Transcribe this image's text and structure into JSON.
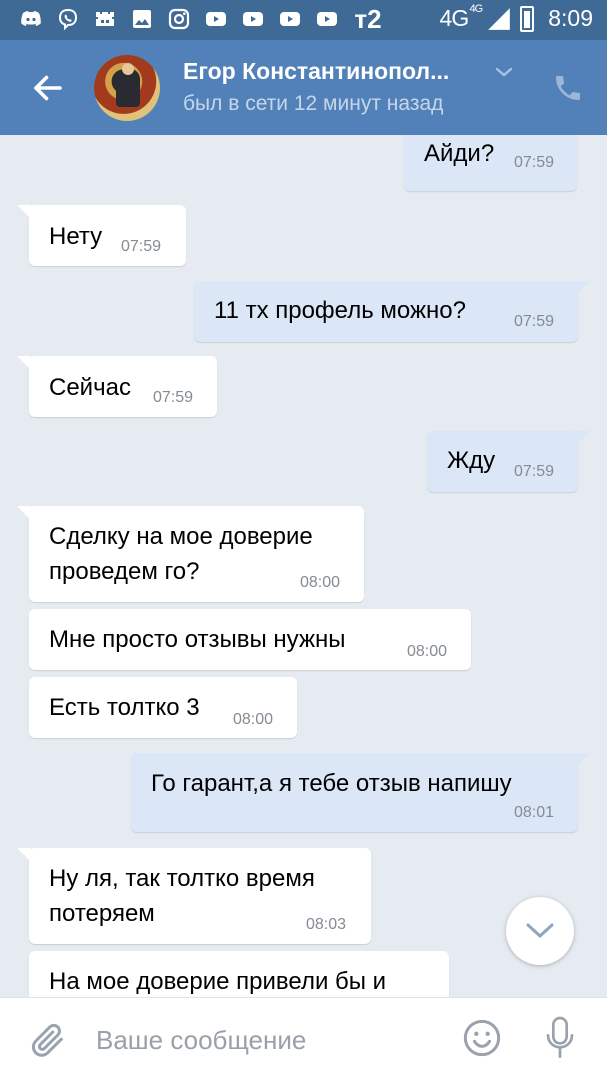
{
  "status_bar": {
    "icons": [
      "discord-icon",
      "viber-icon",
      "game-icon",
      "gallery-icon",
      "instagram-icon",
      "youtube-icon",
      "youtube-icon",
      "youtube-icon",
      "youtube-icon",
      "tele2-icon"
    ],
    "tele2_label": "т2",
    "network": "4G",
    "network_sup": "4G",
    "time": "8:09"
  },
  "header": {
    "contact_name": "Егор Константинопол...",
    "last_seen": "был в сети 12 минут назад"
  },
  "colors": {
    "header_bg": "#5181b8",
    "status_bg": "#3f6a95",
    "incoming_bubble": "#ffffff",
    "outgoing_bubble": "#dbe7f6",
    "chat_bg": "#e5ebf1"
  },
  "messages": [
    {
      "dir": "out",
      "lines": [
        "Айди?"
      ],
      "time": "07:59"
    },
    {
      "dir": "in",
      "lines": [
        "Нету"
      ],
      "time": "07:59"
    },
    {
      "dir": "out",
      "lines": [
        "11 тх профель можно?"
      ],
      "time": "07:59"
    },
    {
      "dir": "in",
      "lines": [
        "Сейчас"
      ],
      "time": "07:59"
    },
    {
      "dir": "out",
      "lines": [
        "Жду"
      ],
      "time": "07:59"
    },
    {
      "dir": "in",
      "lines": [
        "Сделку на мое доверие",
        "проведем го?"
      ],
      "time": "08:00"
    },
    {
      "dir": "in",
      "lines": [
        "Мне просто отзывы нужны"
      ],
      "time": "08:00"
    },
    {
      "dir": "in",
      "lines": [
        "Есть толтко 3"
      ],
      "time": "08:00"
    },
    {
      "dir": "out",
      "lines": [
        "Го гарант,а я тебе отзыв напишу"
      ],
      "time": "08:01"
    },
    {
      "dir": "in",
      "lines": [
        "Ну ля, так толтко время",
        "потеряем"
      ],
      "time": "08:03"
    },
    {
      "dir": "in",
      "lines": [
        "На мое доверие привели бы и"
      ],
      "time": ""
    }
  ],
  "composer": {
    "placeholder": "Ваше сообщение"
  }
}
